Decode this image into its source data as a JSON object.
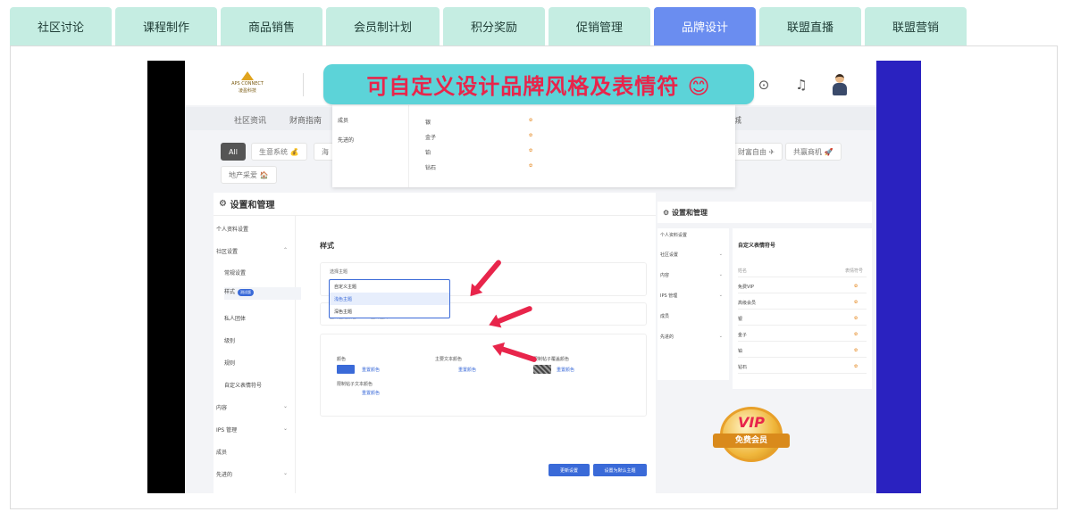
{
  "tabs": [
    {
      "label": "社区讨论",
      "active": false
    },
    {
      "label": "课程制作",
      "active": false
    },
    {
      "label": "商品销售",
      "active": false
    },
    {
      "label": "会员制计划",
      "active": false
    },
    {
      "label": "积分奖励",
      "active": false
    },
    {
      "label": "促销管理",
      "active": false
    },
    {
      "label": "品牌设计",
      "active": true
    },
    {
      "label": "联盟直播",
      "active": false
    },
    {
      "label": "联盟营销",
      "active": false
    }
  ],
  "banner": {
    "text": "可自定义设计品牌风格及表情符 😊"
  },
  "app": {
    "logo_text": "APS CONNECT",
    "logo_sub": "凌盈科技",
    "nav": [
      "社区资讯",
      "财商指南",
      "城"
    ],
    "chips": [
      "All",
      "生意系统 💰",
      "海",
      "财富自由 ✈",
      "共赢商机 🚀",
      "地产采爱 🏠"
    ],
    "popup": {
      "left_items": [
        "成员",
        "先进的"
      ],
      "rows": [
        "银",
        "金子",
        "铂",
        "钻石"
      ],
      "emoji": "✿"
    },
    "settings": {
      "title": "设置和管理",
      "sidebar": {
        "profile": "个人资料设置",
        "community": "社区设置",
        "general": "常规设置",
        "style": "样式",
        "style_badge": "测试版",
        "private_groups": "私人团体",
        "levels": "级别",
        "rules": "规则",
        "custom_emoji": "自定义表情符号",
        "content": "内容",
        "ips": "IPS 管理",
        "members": "成员",
        "advanced": "先进的"
      },
      "section_title": "样式",
      "theme_label": "选择主题",
      "theme_options": [
        "自定义主题",
        "浅色主题",
        "深色主题"
      ],
      "upload_label": "上传主题颜色",
      "upload_hint": "上传图片...",
      "colors": {
        "color": "颜色",
        "main_text_color": "主要文本颜色",
        "pinned_cover_color": "限制帖子覆盖颜色",
        "pinned_text_color": "限制帖子文本颜色",
        "reset": "重置颜色"
      },
      "buttons": {
        "update": "更新设置",
        "set_default": "设置为默认主题"
      }
    },
    "emoji_panel": {
      "title": "设置和管理",
      "sidebar": [
        "个人资料设置",
        "社区设置",
        "内容",
        "IPS 管理",
        "成员",
        "先进的"
      ],
      "table_title": "自定义表情符号",
      "col_name": "姓名",
      "col_emoji": "表情符号",
      "rows": [
        "免费VIP",
        "高级会员",
        "银",
        "金子",
        "铂",
        "钻石"
      ],
      "emoji": "✿"
    },
    "vip": {
      "title": "VIP",
      "ribbon": "免费会员"
    }
  },
  "colors": {
    "tab_bg": "#c5ede2",
    "tab_active": "#6a8df0",
    "banner_bg": "#5cd3d8",
    "banner_text": "#e8254b",
    "accent": "#3a6ad8"
  }
}
